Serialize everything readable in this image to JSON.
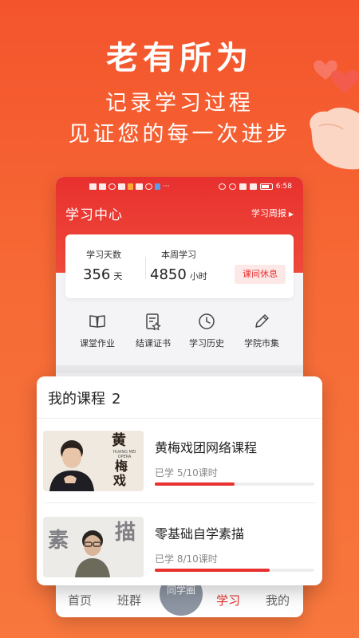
{
  "hero": {
    "title": "老有所为",
    "line1": "记录学习过程",
    "line2": "见证您的每一次进步"
  },
  "status_bar": {
    "time": "6:58"
  },
  "header": {
    "title": "学习中心",
    "weekly_report": "学习周报"
  },
  "stats": {
    "days_label": "学习天数",
    "days_value": "356",
    "days_unit": "天",
    "week_label": "本周学习",
    "week_value": "4850",
    "week_unit": "小时",
    "rest_button": "课间休息"
  },
  "shortcuts": [
    {
      "label": "课堂作业",
      "icon": "book-icon"
    },
    {
      "label": "结课证书",
      "icon": "certificate-icon"
    },
    {
      "label": "学习历史",
      "icon": "clock-icon"
    },
    {
      "label": "学院市集",
      "icon": "pencil-icon"
    }
  ],
  "courses": {
    "title": "我的课程",
    "count": "2",
    "items": [
      {
        "name": "黄梅戏团网络课程",
        "progress_text": "已学 5/10课时",
        "progress": 0.5,
        "thumb_text": "黄梅戏",
        "thumb_sub": "HUANG MEI OPERA"
      },
      {
        "name": "零基础自学素描",
        "progress_text": "已学 8/10课时",
        "progress": 0.72,
        "thumb_text": "素描"
      }
    ]
  },
  "tabbar": {
    "home": "首页",
    "class": "班群",
    "center": "同学圈",
    "study": "学习",
    "mine": "我的"
  },
  "colors": {
    "accent": "#e8302f",
    "background": "#f4542c"
  }
}
